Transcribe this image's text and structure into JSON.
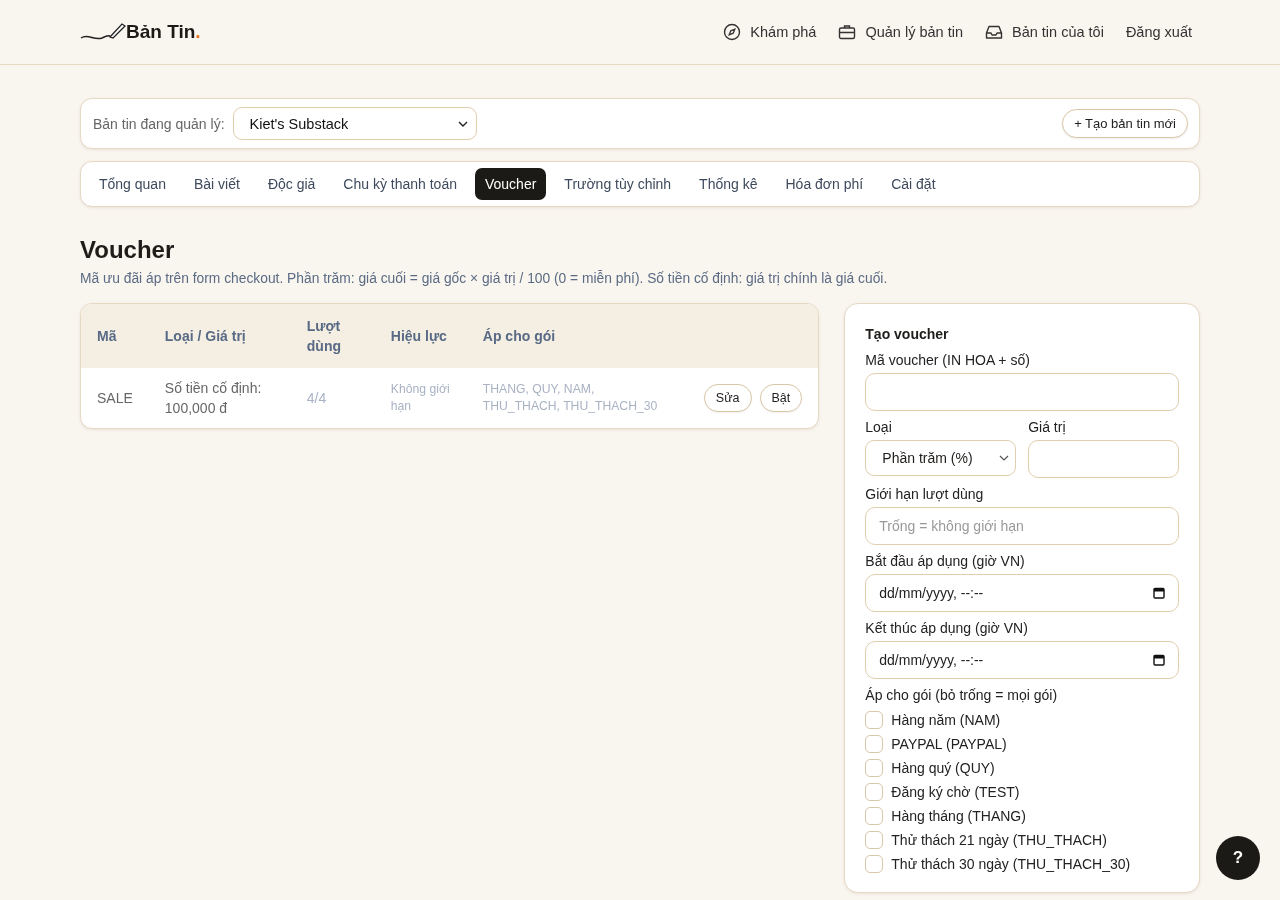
{
  "brand": {
    "name": "Bản Tin",
    "dot": "."
  },
  "nav": [
    {
      "label": "Khám phá",
      "kind": "compass"
    },
    {
      "label": "Quản lý bản tin",
      "kind": "briefcase"
    },
    {
      "label": "Bản tin của tôi",
      "kind": "inbox"
    },
    {
      "label": "Đăng xuất",
      "kind": "none"
    }
  ],
  "manager": {
    "label": "Bản tin đang quản lý:",
    "value": "Kiet's Substack",
    "new_button": "+ Tạo bản tin mới"
  },
  "tabs": [
    {
      "label": "Tổng quan",
      "selected": false
    },
    {
      "label": "Bài viết",
      "selected": false
    },
    {
      "label": "Độc giả",
      "selected": false
    },
    {
      "label": "Chu kỳ thanh toán",
      "selected": false
    },
    {
      "label": "Voucher",
      "selected": true
    },
    {
      "label": "Trường tùy chỉnh",
      "selected": false
    },
    {
      "label": "Thống kê",
      "selected": false
    },
    {
      "label": "Hóa đơn phí",
      "selected": false
    },
    {
      "label": "Cài đặt",
      "selected": false
    }
  ],
  "page": {
    "title": "Voucher",
    "description": "Mã ưu đãi áp trên form checkout. Phần trăm: giá cuối = giá gốc × giá trị / 100 (0 = miễn phí). Số tiền cố định: giá trị chính là giá cuối."
  },
  "table": {
    "columns": [
      "Mã",
      "Loại / Giá trị",
      "Lượt dùng",
      "Hiệu lực",
      "Áp cho gói"
    ],
    "rows": [
      {
        "code": "SALE",
        "type": "Số tiền cố định: 100,000 đ",
        "usage": "4/4",
        "validity": "Không giới hạn",
        "plans": "THANG, QUY, NAM, THU_THACH, THU_THACH_30",
        "actions": [
          "Sửa",
          "Bật"
        ]
      }
    ]
  },
  "form": {
    "title": "Tạo voucher",
    "code": {
      "label": "Mã voucher (IN HOA + số)"
    },
    "type": {
      "label": "Loại",
      "value": "Phần trăm (%)"
    },
    "value": {
      "label": "Giá trị"
    },
    "limit": {
      "label": "Giới hạn lượt dùng",
      "placeholder": "Trống = không giới hạn"
    },
    "start": {
      "label": "Bắt đầu áp dụng (giờ VN)",
      "placeholder": "dd/mm/yyyy, --:--"
    },
    "end": {
      "label": "Kết thúc áp dụng (giờ VN)",
      "placeholder": "dd/mm/yyyy, --:--"
    },
    "plans_label": "Áp cho gói (bỏ trống = mọi gói)",
    "plans": [
      {
        "label": "Hàng năm (NAM)",
        "checked": false
      },
      {
        "label": "PAYPAL (PAYPAL)",
        "checked": false
      },
      {
        "label": "Hàng quý (QUY)",
        "checked": false
      },
      {
        "label": "Đăng ký chờ (TEST)",
        "checked": false
      },
      {
        "label": "Hàng tháng (THANG)",
        "checked": false
      },
      {
        "label": "Thử thách 21 ngày (THU_THACH)",
        "checked": false
      },
      {
        "label": "Thử thách 30 ngày (THU_THACH_30)",
        "checked": false
      }
    ]
  },
  "help_button": "?"
}
